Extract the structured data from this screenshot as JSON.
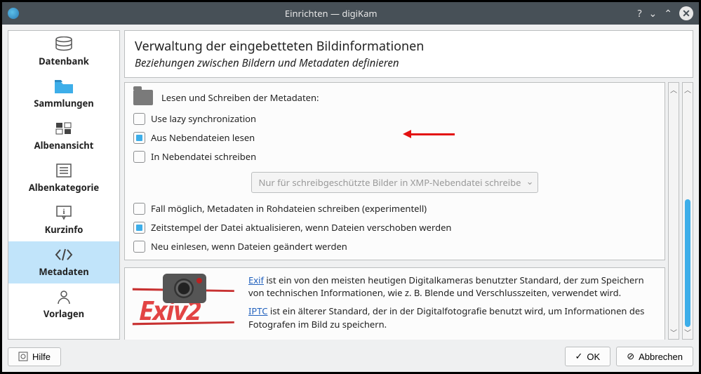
{
  "window": {
    "title": "Einrichten — digiKam"
  },
  "sidebar": {
    "items": [
      {
        "label": "Datenbank"
      },
      {
        "label": "Sammlungen"
      },
      {
        "label": "Albenansicht"
      },
      {
        "label": "Albenkategorie"
      },
      {
        "label": "Kurzinfo"
      },
      {
        "label": "Metadaten"
      },
      {
        "label": "Vorlagen"
      }
    ]
  },
  "header": {
    "title": "Verwaltung der eingebetteten Bildinformationen",
    "subtitle": "Beziehungen zwischen Bildern und Metadaten definieren"
  },
  "metadata_group": {
    "heading": "Lesen und Schreiben der Metadaten:",
    "lazy_sync": "Use lazy synchronization",
    "read_sidecar": "Aus Nebendateien lesen",
    "write_sidecar": "In Nebendatei schreiben",
    "select_value": "Nur für schreibgeschützte Bilder in XMP-Nebendatei schreibe",
    "raw_write": "Fall möglich, Metadaten in Rohdateien schreiben (experimentell)",
    "update_timestamp": "Zeitstempel der Datei aktualisieren, wenn Dateien verschoben werden",
    "rescan": "Neu einlesen, wenn Dateien geändert werden"
  },
  "info": {
    "exif_link": "Exif",
    "exif_text": " ist ein von den meisten heutigen Digitalkameras benutzter Standard, der zum Speichern von technischen Informationen, wie z. B. Blende und Verschlusszeiten, verwendet wird.",
    "iptc_link": "IPTC",
    "iptc_text": " ist ein älterer Standard, der in der Digitalfotografie benutzt wird, um Informationen des Fotografen im Bild zu speichern."
  },
  "footer": {
    "help": "Hilfe",
    "ok": "OK",
    "cancel": "Abbrechen"
  }
}
